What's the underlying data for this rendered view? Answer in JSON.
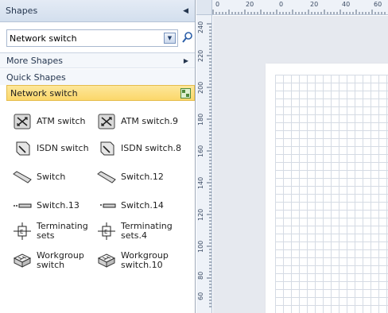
{
  "pane": {
    "title": "Shapes",
    "search_value": "Network switch",
    "more_shapes": "More Shapes",
    "quick_shapes": "Quick Shapes",
    "stencil_name": "Network switch"
  },
  "shapes": [
    {
      "label": "ATM switch",
      "icon": "atm-switch-icon"
    },
    {
      "label": "ATM switch.9",
      "icon": "atm-switch-icon"
    },
    {
      "label": "ISDN switch",
      "icon": "isdn-switch-icon"
    },
    {
      "label": "ISDN switch.8",
      "icon": "isdn-switch-icon"
    },
    {
      "label": "Switch",
      "icon": "switch-icon"
    },
    {
      "label": "Switch.12",
      "icon": "switch-icon"
    },
    {
      "label": "Switch.13",
      "icon": "switch-flat-icon"
    },
    {
      "label": "Switch.14",
      "icon": "switch-flat-icon"
    },
    {
      "label": "Terminating sets",
      "icon": "terminating-set-icon"
    },
    {
      "label": "Terminating sets.4",
      "icon": "terminating-set-icon"
    },
    {
      "label": "Workgroup switch",
      "icon": "workgroup-switch-icon"
    },
    {
      "label": "Workgroup switch.10",
      "icon": "workgroup-switch-icon"
    }
  ],
  "ruler": {
    "horizontal": [
      "0",
      "20",
      "0",
      "20",
      "40",
      "60"
    ],
    "vertical": [
      "240",
      "220",
      "200",
      "180",
      "160",
      "140",
      "120",
      "100",
      "80",
      "60"
    ]
  },
  "colors": {
    "stencil_highlight": "#fbd76a",
    "pane_header": "#d3dfee",
    "canvas_bg": "#e6e9ef"
  }
}
